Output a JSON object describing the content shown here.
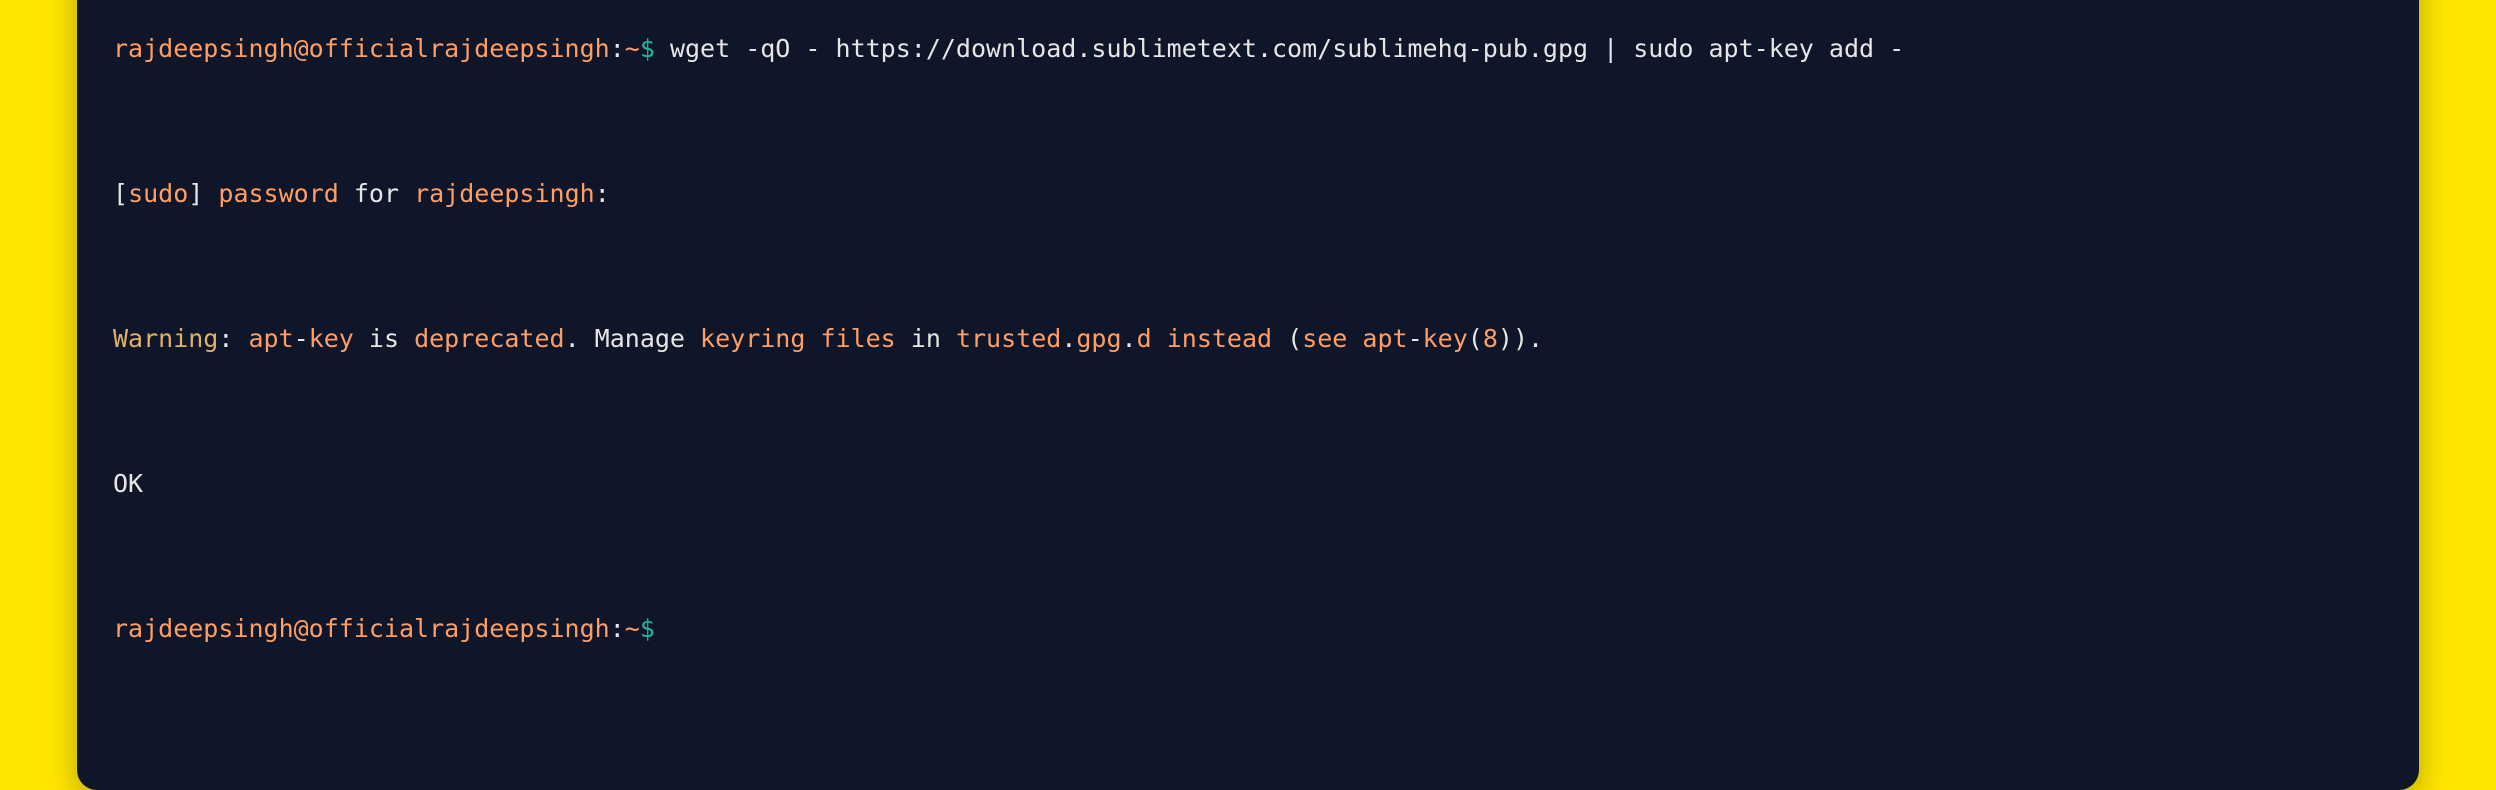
{
  "prompt": {
    "user_host": "rajdeepsingh@officialrajdeepsingh",
    "sep1": ":",
    "path": "~",
    "sep2": "$",
    "space": " "
  },
  "cmd": "wget -qO - https://download.sublimetext.com/sublimehq-pub.gpg | sudo apt-key add -",
  "line2": {
    "p1": "[",
    "p2": "sudo",
    "p3": "] ",
    "p4": "password",
    "p5": " for ",
    "p6": "rajdeepsingh",
    "p7": ":"
  },
  "line3": {
    "p1": "Warning",
    "p2": ": ",
    "p3": "apt",
    "p4": "-",
    "p5": "key",
    "p6": " is ",
    "p7": "deprecated",
    "p8": ". Manage ",
    "p9": "keyring",
    "p10": " ",
    "p11": "files",
    "p12": " in ",
    "p13": "trusted",
    "p14": ".",
    "p15": "gpg",
    "p16": ".",
    "p17": "d",
    "p18": " ",
    "p19": "instead",
    "p20": " (",
    "p21": "see",
    "p22": " ",
    "p23": "apt",
    "p24": "-",
    "p25": "key",
    "p26": "(",
    "p27": "8",
    "p28": "))."
  },
  "line4": "OK",
  "colors": {
    "bg_page": "#ffe600",
    "bg_terminal": "#0f1629",
    "orange": "#ff9e64",
    "white": "#e6e6e6",
    "teal": "#1abc9c",
    "yellow": "#e0af68",
    "dot_red": "#ff5f57",
    "dot_yellow": "#febc2e",
    "dot_green": "#28c840"
  }
}
